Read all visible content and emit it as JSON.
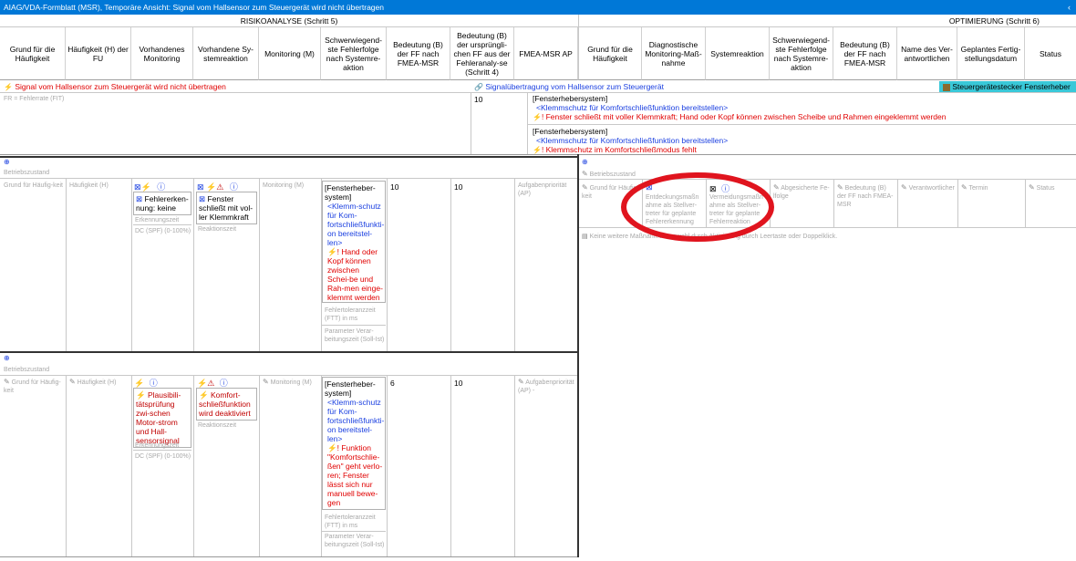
{
  "window": {
    "title": "AIAG/VDA-Formblatt (MSR), Temporäre Ansicht: Signal vom Hallsensor zum Steuergerät wird nicht übertragen",
    "collapse_glyph": "‹"
  },
  "sections": {
    "risk": "RISIKOANALYSE (Schritt 5)",
    "opt": "OPTIMIERUNG (Schritt 6)"
  },
  "columns": {
    "risk": [
      "Grund für die Häufigkeit",
      "Häufigkeit (H) der FU",
      "Vorhandenes Monitoring",
      "Vorhandene Sy-stemreaktion",
      "Monitoring (M)",
      "Schwerwiegend-ste Fehlerfolge nach Systemre-aktion",
      "Bedeutung (B) der FF nach FMEA-MSR",
      "Bedeutung (B) der ursprüngli-chen FF aus der Fehleranaly-se (Schritt 4)",
      "FMEA-MSR AP"
    ],
    "opt": [
      "Grund für die Häufigkeit",
      "Diagnostische Monitoring-Maß-nahme",
      "Systemreaktion",
      "Schwerwiegend-ste Fehlerfolge nach Systemre-aktion",
      "Bedeutung (B) der FF nach FMEA-MSR",
      "Name des Ver-antwortlichen",
      "Geplantes Fertig-stellungsdatum",
      "Status"
    ]
  },
  "failure_bar": {
    "cause": "Signal vom Hallsensor zum Steuergerät wird nicht übertragen",
    "function": "Signalübertragung vom Hallsensor zum Steuergerät",
    "element": "Steuergerätestecker Fensterheber"
  },
  "fit_row": {
    "fit_label": "FR = Fehlerrate (FIT)",
    "severity": "10",
    "effects": [
      {
        "system": "[Fensterhebersystem]",
        "function": "<Klemmschutz für Komfortschließfunktion bereitstellen>",
        "failure": "Fenster schließt mit voller Klemmkraft; Hand oder Kopf können zwischen Scheibe und Rahmen eingeklemmt werden"
      },
      {
        "system": "[Fensterhebersystem]",
        "function": "<Klemmschutz für Komfortschließfunktion bereitstellen>",
        "failure": "Klemmschutz im Komfortschließmodus fehlt"
      }
    ]
  },
  "block1": {
    "state_label": "Betriebszustand",
    "reason_ph": "Grund für Häufig-keit",
    "freq_ph": "Häufigkeit (H)",
    "monitoring_text": "Fehlererken-nung: keine",
    "detect_time": "Erkennungszeit",
    "dc_label": "DC (SPF) (0-100%)",
    "reaction_text": "Fenster schließt mit vol-ler Klemmkraft",
    "reaction_time": "Reaktionszeit",
    "m_ph": "Monitoring (M)",
    "effect_system": "[Fensterheber-system]",
    "effect_function": "<Klemm-schutz für Kom-fortschließfunkti-on bereitstel-len>",
    "effect_failure": "Hand oder Kopf können zwischen Schei-be und Rah-men einge-klemmt werden",
    "ftt_label": "Fehlertoleranzzeit (FTT) in ms",
    "param_label": "Parameter Verar-beitungszeit (Soll-Ist)",
    "sev1": "10",
    "sev2": "10",
    "ap_ph": "Aufgabenpriorität (AP)"
  },
  "block2": {
    "state_label": "Betriebszustand",
    "reason_ph": "Grund für Häufig-keit",
    "freq_ph": "Häufigkeit (H)",
    "monitoring_text": "Plausibili-tätsprüfung zwi-schen Motor-strom und Hall-sensorsignal",
    "detect_time": "Erkennungszeit",
    "dc_label": "DC (SPF) (0-100%)",
    "reaction_text": "Komfort-schließfunktion wird deaktiviert",
    "reaction_time": "Reaktionszeit",
    "m_ph": "Monitoring (M)",
    "effect_system": "[Fensterheber-system]",
    "effect_function": "<Klemm-schutz für Kom-fortschließfunkti-on bereitstel-len>",
    "effect_failure": "Funktion \"Komfortschlie-ßen\" geht verlo-ren; Fenster lässt sich nur manuell bewe-gen",
    "ftt_label": "Fehlertoleranzzeit (FTT) in ms",
    "param_label": "Parameter Verar-beitungszeit (Soll-Ist)",
    "sev1": "6",
    "sev2": "10",
    "ap_ph": "Aufgabenpriorität (AP) -"
  },
  "opt_block": {
    "state_label": "Betriebszustand",
    "reason_ph": "Grund für Häufig-keit",
    "detect_ph": "Entdeckungsmaßn ahme als Stellver-treter für geplante Fehlererkennung",
    "avoid_ph": "Vermeidungsmaßn ahme als Stellver-treter für geplante Fehlerreaktion",
    "secured_ph": "Abgesicherte Fe-lfolge",
    "sev_ph": "Bedeutung (B) der FF nach FMEA-MSR",
    "resp_ph": "Verantwortlicher",
    "date_ph": "Termin",
    "status_ph": "Status",
    "hint": "Keine weitere Maßnahme. Auswahl durch Aktivierung durch Leertaste oder Doppelklick."
  },
  "colors": {
    "titlebar": "#0078d7",
    "element_badge": "#39c8d8",
    "highlight_oval": "#e0141e"
  }
}
